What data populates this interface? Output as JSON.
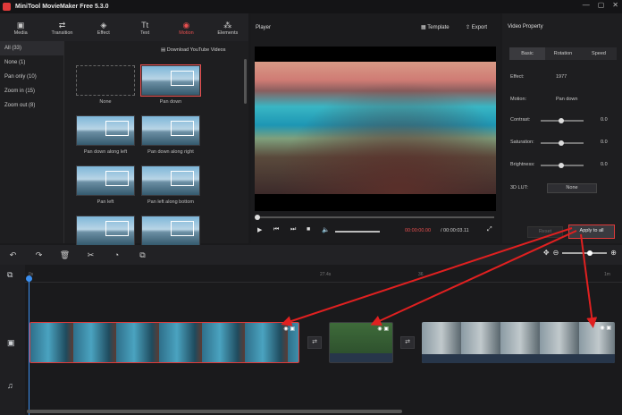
{
  "app": {
    "title": "MiniTool MovieMaker Free 5.3.0",
    "win_buttons": [
      "—",
      "▢",
      "✕"
    ]
  },
  "toolbar": [
    {
      "label": "Media",
      "icon": "▣"
    },
    {
      "label": "Transition",
      "icon": "⇄"
    },
    {
      "label": "Effect",
      "icon": "◈"
    },
    {
      "label": "Text",
      "icon": "Tt"
    },
    {
      "label": "Motion",
      "icon": "◉"
    },
    {
      "label": "Elements",
      "icon": "⁂"
    }
  ],
  "library": {
    "categories": [
      "All (33)",
      "None (1)",
      "Pan only (10)",
      "Zoom in (15)",
      "Zoom out (8)"
    ],
    "download": "Download YouTube Videos",
    "tiles": [
      "None",
      "Pan down",
      "Pan down along left",
      "Pan down along right",
      "Pan left",
      "Pan left along bottom",
      "",
      ""
    ]
  },
  "player": {
    "title": "Player",
    "template": "Template",
    "export": "Export",
    "time_current": "00:00:00.00",
    "time_total": "/ 00:00:03.11"
  },
  "property": {
    "title": "Video Property",
    "tabs": [
      "Basic",
      "Rotation",
      "Speed"
    ],
    "effect_label": "Effect:",
    "effect_value": "1977",
    "motion_label": "Motion:",
    "motion_value": "Pan down",
    "contrast_label": "Contrast:",
    "contrast_value": "0.0",
    "saturation_label": "Saturation:",
    "saturation_value": "0.0",
    "brightness_label": "Brightness:",
    "brightness_value": "0.0",
    "lut_label": "3D LUT:",
    "lut_value": "None",
    "reset": "Reset",
    "apply": "Apply to all"
  },
  "timeline": {
    "ruler_marks": [
      "0s",
      "27.4s",
      "36",
      "1m"
    ]
  },
  "accent": "#e03a3a"
}
